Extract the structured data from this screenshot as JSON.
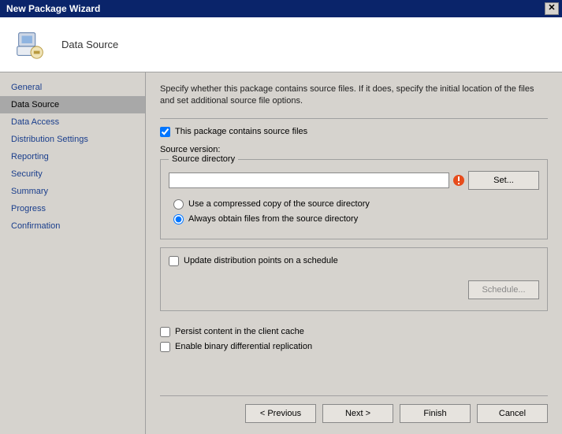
{
  "titlebar": {
    "text": "New Package Wizard"
  },
  "header": {
    "title": "Data Source"
  },
  "sidebar": {
    "items": [
      {
        "label": "General"
      },
      {
        "label": "Data Source"
      },
      {
        "label": "Data Access"
      },
      {
        "label": "Distribution Settings"
      },
      {
        "label": "Reporting"
      },
      {
        "label": "Security"
      },
      {
        "label": "Summary"
      },
      {
        "label": "Progress"
      },
      {
        "label": "Confirmation"
      }
    ],
    "active_index": 1
  },
  "main": {
    "intro": "Specify whether this package contains source files. If it does, specify the initial location of the files and set additional source file options.",
    "contains_source": {
      "checked": true,
      "label": "This package contains source files"
    },
    "source_version_label": "Source version:",
    "source_dir": {
      "legend": "Source directory",
      "value": "",
      "set_btn": "Set..."
    },
    "radio": {
      "compressed": {
        "checked": false,
        "label": "Use a compressed copy of the source directory"
      },
      "always": {
        "checked": true,
        "label": "Always obtain files from the source directory"
      }
    },
    "update_dp": {
      "checked": false,
      "label": "Update distribution points on a schedule",
      "schedule_btn": "Schedule..."
    },
    "persist_cache": {
      "checked": false,
      "label": "Persist content in the client cache"
    },
    "binary_diff": {
      "checked": false,
      "label": "Enable binary differential replication"
    }
  },
  "buttons": {
    "previous": "< Previous",
    "next": "Next >",
    "finish": "Finish",
    "cancel": "Cancel"
  }
}
